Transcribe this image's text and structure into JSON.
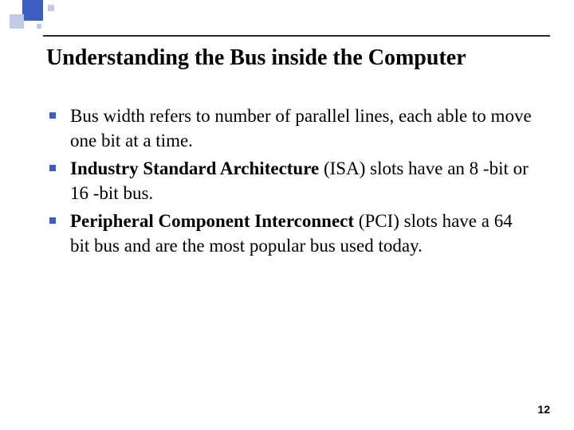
{
  "title": "Understanding the Bus inside the Computer",
  "bullets": [
    {
      "pre": "Bus width refers to number of parallel lines, each able to move one bit at a time.",
      "bold": "",
      "post": ""
    },
    {
      "pre": "",
      "bold": "Industry Standard Architecture",
      "post": " (ISA) slots have an 8 -bit or 16 -bit bus."
    },
    {
      "pre": "",
      "bold": "Peripheral Component Interconnect",
      "post": " (PCI) slots have a 64 bit bus and are the most popular bus used today."
    }
  ],
  "page_number": "12"
}
